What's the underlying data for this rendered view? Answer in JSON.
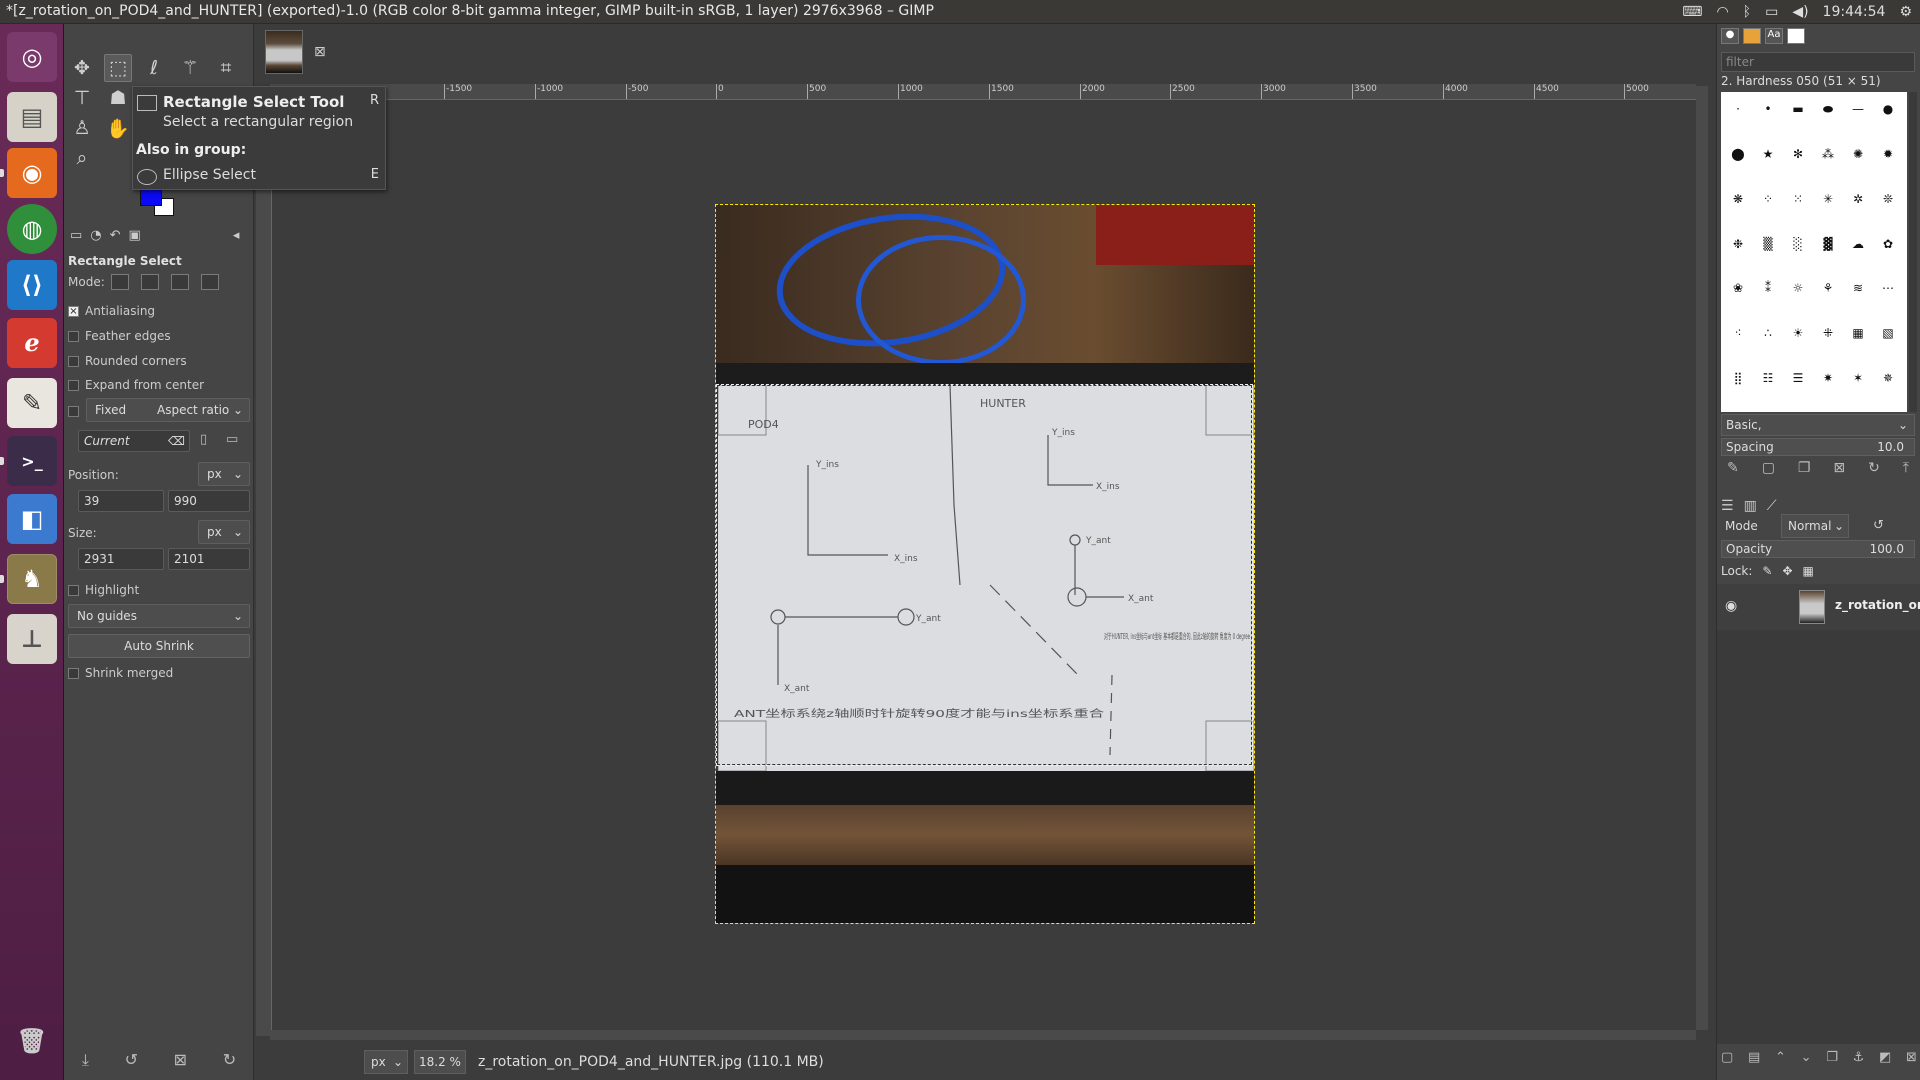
{
  "window": {
    "title": "*[z_rotation_on_POD4_and_HUNTER] (exported)-1.0 (RGB color 8-bit gamma integer, GIMP built-in sRGB, 1 layer) 2976x3968 – GIMP",
    "clock": "19:44:54"
  },
  "launcher": {
    "items": [
      "ubuntu-dash-icon",
      "files-icon",
      "firefox-icon",
      "chrome-icon",
      "vscode-icon",
      "pdf-viewer-icon",
      "text-editor-icon",
      "terminal-icon",
      "app-icon",
      "gimp-icon",
      "installer-icon",
      "trash-icon"
    ]
  },
  "tooltip": {
    "title": "Rectangle Select Tool",
    "shortcut": "R",
    "description": "Select a rectangular region",
    "group_heading": "Also in group:",
    "group_item": "Ellipse Select",
    "group_item_shortcut": "E"
  },
  "tool_options": {
    "title": "Rectangle Select",
    "mode_label": "Mode:",
    "antialiasing": "Antialiasing",
    "feather_edges": "Feather edges",
    "rounded_corners": "Rounded corners",
    "expand_from_center": "Expand from center",
    "fixed": "Fixed",
    "aspect_ratio": "Aspect ratio",
    "current": "Current",
    "position_label": "Position:",
    "position_unit": "px",
    "position_x": "39",
    "position_y": "990",
    "size_label": "Size:",
    "size_unit": "px",
    "size_w": "2931",
    "size_h": "2101",
    "highlight": "Highlight",
    "guides": "No guides",
    "auto_shrink": "Auto Shrink",
    "shrink_merged": "Shrink merged"
  },
  "ruler": {
    "h_ticks": [
      "-1500",
      "-1000",
      "-500",
      "0",
      "500",
      "1000",
      "1500",
      "2000",
      "2500",
      "3000",
      "3500",
      "4000",
      "4500",
      "5000"
    ]
  },
  "paper_text": {
    "pod4": "POD4",
    "hunter": "HUNTER",
    "y_ins_1": "Y_ins",
    "x_ins_1": "X_ins",
    "y_ins_2": "Y_ins",
    "x_ins_2": "X_ins",
    "y_ant_1": "Y_ant",
    "x_ant_1": "X_ant",
    "y_ant_2": "Y_ant",
    "x_ant_2": "X_ant",
    "note_right": "对于HUNTER, ins坐标与ant坐标 基本都是重合的, 因此z轴的旋转 角度为 0 degree",
    "note_bottom": "ANT坐标系绕z轴顺时针旋转90度才能与ins坐标系重合"
  },
  "statusbar": {
    "unit": "px",
    "zoom": "18.2 %",
    "file": "z_rotation_on_POD4_and_HUNTER.jpg (110.1 MB)"
  },
  "brushes": {
    "filter_placeholder": "filter",
    "selected": "2. Hardness 050 (51 × 51)",
    "set": "Basic,",
    "spacing_label": "Spacing",
    "spacing_value": "10.0"
  },
  "layers": {
    "mode_label": "Mode",
    "mode": "Normal",
    "opacity_label": "Opacity",
    "opacity_value": "100.0",
    "lock_label": "Lock:",
    "layer_name": "z_rotation_on"
  },
  "colors": {
    "foreground": "#0a0af5",
    "background": "#ffffff",
    "selection_marching": "#ffe800"
  }
}
